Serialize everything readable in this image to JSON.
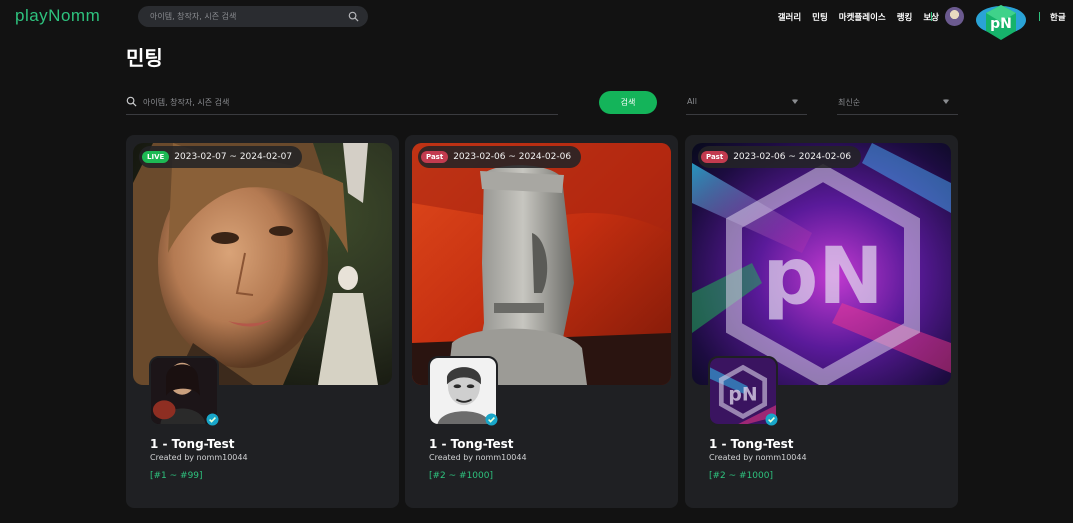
{
  "app": {
    "logo": "playNomm"
  },
  "header": {
    "search_placeholder": "아이템, 창작자, 시즌 검색",
    "nav": [
      "갤러리",
      "민팅",
      "마켓플레이스",
      "랭킹",
      "보상"
    ],
    "brand_badge": "pN",
    "language": "한글"
  },
  "page": {
    "title": "민팅"
  },
  "filters": {
    "search_placeholder": "아이템, 창작자, 시즌 검색",
    "search_button": "검색",
    "status_value": "All",
    "sort_value": "최신순"
  },
  "colors": {
    "accent": "#2ec27e",
    "button": "#14b45a",
    "live": "#1db954",
    "past": "#c23b4f",
    "card": "#1f2023",
    "background": "#121212"
  },
  "cards": [
    {
      "status": "LIVE",
      "period": "2023-02-07 ~ 2024-02-07",
      "title": "1 - Tong-Test",
      "creator": "Created by nomm10044",
      "range": "[#1 ~ #99]"
    },
    {
      "status": "Past",
      "period": "2023-02-06 ~ 2024-02-06",
      "title": "1 - Tong-Test",
      "creator": "Created by nomm10044",
      "range": "[#2 ~ #1000]"
    },
    {
      "status": "Past",
      "period": "2023-02-06 ~ 2024-02-06",
      "title": "1 - Tong-Test",
      "creator": "Created by nomm10044",
      "range": "[#2 ~ #1000]"
    }
  ]
}
